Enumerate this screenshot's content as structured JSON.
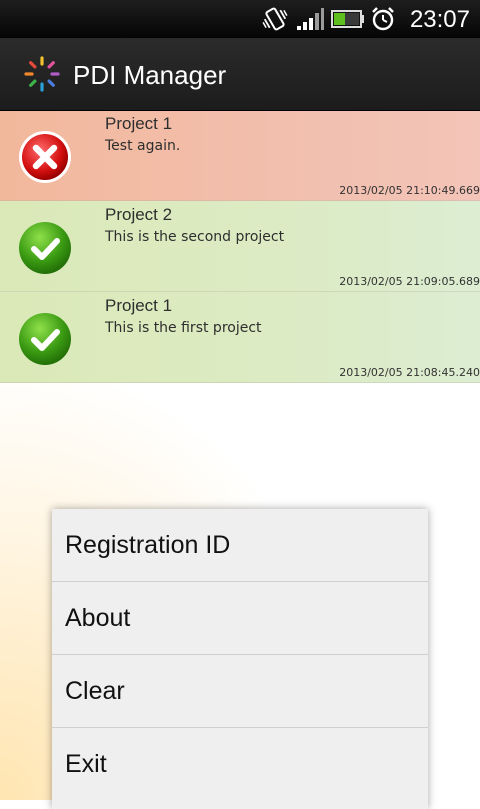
{
  "status_bar": {
    "time": "23:07",
    "icons": [
      "vibrate-icon",
      "signal-icon",
      "battery-icon",
      "alarm-icon"
    ]
  },
  "app": {
    "title": "PDI Manager",
    "logo_icon": "spinner-logo-icon"
  },
  "projects": [
    {
      "name": "Project 1",
      "description": "Test again.",
      "timestamp": "2013/02/05 21:10:49.669",
      "status": "error",
      "status_icon": "error-cross-icon",
      "color": "#f2bca6"
    },
    {
      "name": "Project 2",
      "description": "This is the second project",
      "timestamp": "2013/02/05 21:09:05.689",
      "status": "ok",
      "status_icon": "check-icon",
      "color": "#dbe9c0"
    },
    {
      "name": "Project 1",
      "description": "This is the first project",
      "timestamp": "2013/02/05 21:08:45.240",
      "status": "ok",
      "status_icon": "check-icon",
      "color": "#dbe9c0"
    }
  ],
  "menu": {
    "items": [
      {
        "label": "Registration ID"
      },
      {
        "label": "About"
      },
      {
        "label": "Clear"
      },
      {
        "label": "Exit"
      }
    ]
  }
}
